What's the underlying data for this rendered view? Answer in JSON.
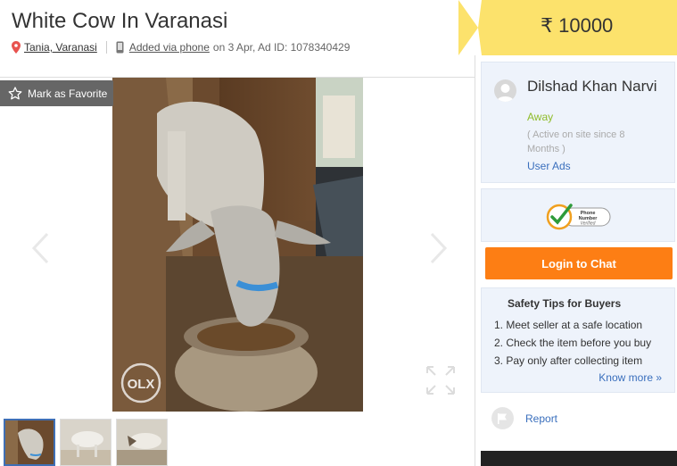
{
  "listing": {
    "title": "White Cow In Varanasi",
    "location": "Tania, Varanasi",
    "added_via": "Added via phone",
    "posted": " on 3 Apr, Ad ID: 1078340429"
  },
  "gallery": {
    "favorite_label": "Mark as Favorite",
    "thumbnail_count": 3,
    "watermark": "OLX"
  },
  "price": {
    "label": "₹ 10000"
  },
  "seller": {
    "name": "Dilshad Khan Narvi",
    "status": "Away",
    "since": "( Active on site since 8 Months )",
    "user_ads": "User Ads",
    "status_color": "#8fbc2a"
  },
  "badge": {
    "line1": "Phone",
    "line2": "Number",
    "line3": "Verified"
  },
  "chat": {
    "label": "Login to Chat",
    "color": "#fd7e14"
  },
  "safety": {
    "title": "Safety Tips for Buyers",
    "tips": [
      "1. Meet seller at a safe location",
      "2. Check the item before you buy",
      "3. Pay only after collecting item"
    ],
    "more": "Know more »"
  },
  "report": {
    "label": "Report"
  },
  "colors": {
    "price_bg": "#fce26c",
    "link": "#3a6fbd",
    "card_bg": "#eef3fb"
  }
}
